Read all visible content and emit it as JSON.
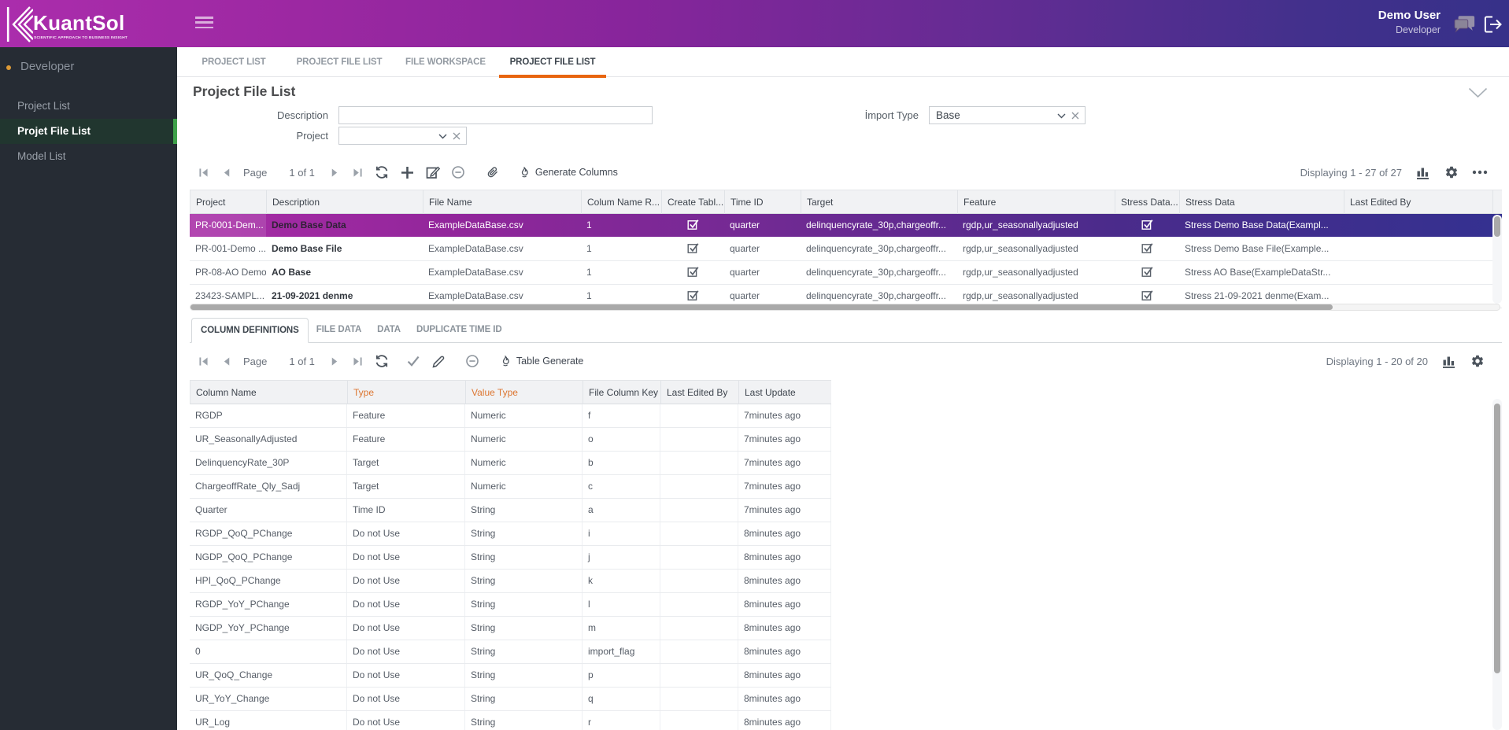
{
  "brand": {
    "name": "KuantSol",
    "tagline": "SCIENTIFIC APPROACH TO BUSINESS INSIGHT"
  },
  "user": {
    "name": "Demo User",
    "role": "Developer"
  },
  "sidebar": {
    "section": "Developer",
    "items": [
      {
        "label": "Project List",
        "active": false
      },
      {
        "label": "Projet File List",
        "active": true
      },
      {
        "label": "Model List",
        "active": false
      }
    ]
  },
  "main_tabs": [
    {
      "label": "PROJECT LIST",
      "active": false
    },
    {
      "label": "PROJECT FILE LIST",
      "active": false
    },
    {
      "label": "FILE WORKSPACE",
      "active": false
    },
    {
      "label": "PROJECT FILE LIST",
      "active": true
    }
  ],
  "page": {
    "title": "Project File List"
  },
  "filters": {
    "description": {
      "label": "Description",
      "value": ""
    },
    "project": {
      "label": "Project",
      "value": ""
    },
    "import_type": {
      "label": "İmport Type",
      "value": "Base"
    }
  },
  "upper_toolbar": {
    "page_label": "Page",
    "page_value": "1 of 1",
    "nav_icons_before": [
      "first-page",
      "prev-page"
    ],
    "nav_icons_after": [
      "next-page",
      "last-page"
    ],
    "action_icons": [
      "refresh",
      "add",
      "edit-row",
      "remove-row",
      "attach"
    ],
    "action": {
      "icon": "generate",
      "label": "Generate Columns"
    },
    "displaying": "Displaying 1 - 27 of 27",
    "right_icons": [
      "bar-chart",
      "settings",
      "ellipsis"
    ]
  },
  "upper_grid": {
    "columns": [
      "Project",
      "Description",
      "File Name",
      "Colum Name R...",
      "Create Tabl...",
      "Time ID",
      "Target",
      "Feature",
      "Stress Data...",
      "Stress Data",
      "Last Edited By"
    ],
    "rows": [
      {
        "selected": true,
        "project": "PR-0001-Dem...",
        "description": "Demo Base Data",
        "file_name": "ExampleDataBase.csv",
        "colum_name_r": "1",
        "create_table": true,
        "time_id": "quarter",
        "target": "delinquencyrate_30p,chargeoffr...",
        "feature": "rgdp,ur_seasonallyadjusted",
        "stress_data_flag": true,
        "stress_data": "Stress Demo Base Data(Exampl...",
        "last_edited_by": ""
      },
      {
        "selected": false,
        "project": "PR-001-Demo ...",
        "description": "Demo Base File",
        "file_name": "ExampleDataBase.csv",
        "colum_name_r": "1",
        "create_table": true,
        "time_id": "quarter",
        "target": "delinquencyrate_30p,chargeoffr...",
        "feature": "rgdp,ur_seasonallyadjusted",
        "stress_data_flag": true,
        "stress_data": "Stress Demo Base File(Example...",
        "last_edited_by": ""
      },
      {
        "selected": false,
        "project": "PR-08-AO Demo",
        "description": "AO Base",
        "file_name": "ExampleDataBase.csv",
        "colum_name_r": "1",
        "create_table": true,
        "time_id": "quarter",
        "target": "delinquencyrate_30p,chargeoffr...",
        "feature": "rgdp,ur_seasonallyadjusted",
        "stress_data_flag": true,
        "stress_data": "Stress AO Base(ExampleDataStr...",
        "last_edited_by": ""
      },
      {
        "selected": false,
        "project": "23423-SAMPL...",
        "description": "21-09-2021 denme",
        "file_name": "ExampleDataBase.csv",
        "colum_name_r": "1",
        "create_table": true,
        "time_id": "quarter",
        "target": "delinquencyrate_30p,chargeoffr...",
        "feature": "rgdp,ur_seasonallyadjusted",
        "stress_data_flag": true,
        "stress_data": "Stress 21-09-2021 denme(Exam...",
        "last_edited_by": ""
      }
    ]
  },
  "detail_tabs": [
    {
      "label": "COLUMN DEFINITIONS",
      "active": true
    },
    {
      "label": "FILE DATA",
      "active": false
    },
    {
      "label": "DATA",
      "active": false
    },
    {
      "label": "DUPLICATE TIME ID",
      "active": false
    }
  ],
  "lower_toolbar": {
    "page_label": "Page",
    "page_value": "1 of 1",
    "nav_icons_before": [
      "first-page",
      "prev-page"
    ],
    "nav_icons_after": [
      "next-page",
      "last-page"
    ],
    "action_icons": [
      "refresh",
      "check",
      "pencil",
      "remove-row"
    ],
    "action": {
      "icon": "generate",
      "label": "Table Generate"
    },
    "displaying": "Displaying 1 - 20 of 20",
    "right_icons": [
      "bar-chart",
      "settings"
    ]
  },
  "lower_grid": {
    "columns": [
      {
        "label": "Column Name",
        "accent": false
      },
      {
        "label": "Type",
        "accent": true
      },
      {
        "label": "Value Type",
        "accent": true
      },
      {
        "label": "File Column Key",
        "accent": false
      },
      {
        "label": "Last Edited By",
        "accent": false
      },
      {
        "label": "Last Update",
        "accent": false
      }
    ],
    "rows": [
      [
        "RGDP",
        "Feature",
        "Numeric",
        "f",
        "",
        "7minutes ago"
      ],
      [
        "UR_SeasonallyAdjusted",
        "Feature",
        "Numeric",
        "o",
        "",
        "7minutes ago"
      ],
      [
        "DelinquencyRate_30P",
        "Target",
        "Numeric",
        "b",
        "",
        "7minutes ago"
      ],
      [
        "ChargeoffRate_Qly_Sadj",
        "Target",
        "Numeric",
        "c",
        "",
        "7minutes ago"
      ],
      [
        "Quarter",
        "Time ID",
        "String",
        "a",
        "",
        "7minutes ago"
      ],
      [
        "RGDP_QoQ_PChange",
        "Do not Use",
        "String",
        "i",
        "",
        "8minutes ago"
      ],
      [
        "NGDP_QoQ_PChange",
        "Do not Use",
        "String",
        "j",
        "",
        "8minutes ago"
      ],
      [
        "HPI_QoQ_PChange",
        "Do not Use",
        "String",
        "k",
        "",
        "8minutes ago"
      ],
      [
        "RGDP_YoY_PChange",
        "Do not Use",
        "String",
        "l",
        "",
        "8minutes ago"
      ],
      [
        "NGDP_YoY_PChange",
        "Do not Use",
        "String",
        "m",
        "",
        "8minutes ago"
      ],
      [
        "0",
        "Do not Use",
        "String",
        "import_flag",
        "",
        "8minutes ago"
      ],
      [
        "UR_QoQ_Change",
        "Do not Use",
        "String",
        "p",
        "",
        "8minutes ago"
      ],
      [
        "UR_YoY_Change",
        "Do not Use",
        "String",
        "q",
        "",
        "8minutes ago"
      ],
      [
        "UR_Log",
        "Do not Use",
        "String",
        "r",
        "",
        "8minutes ago"
      ]
    ]
  },
  "colors": {
    "brand_magenta": "#a32ba3",
    "brand_indigo": "#363189",
    "accent_orange": "#e8650f",
    "sidebar_green": "#3fa14a",
    "column_accent_orange": "#dd7732"
  }
}
